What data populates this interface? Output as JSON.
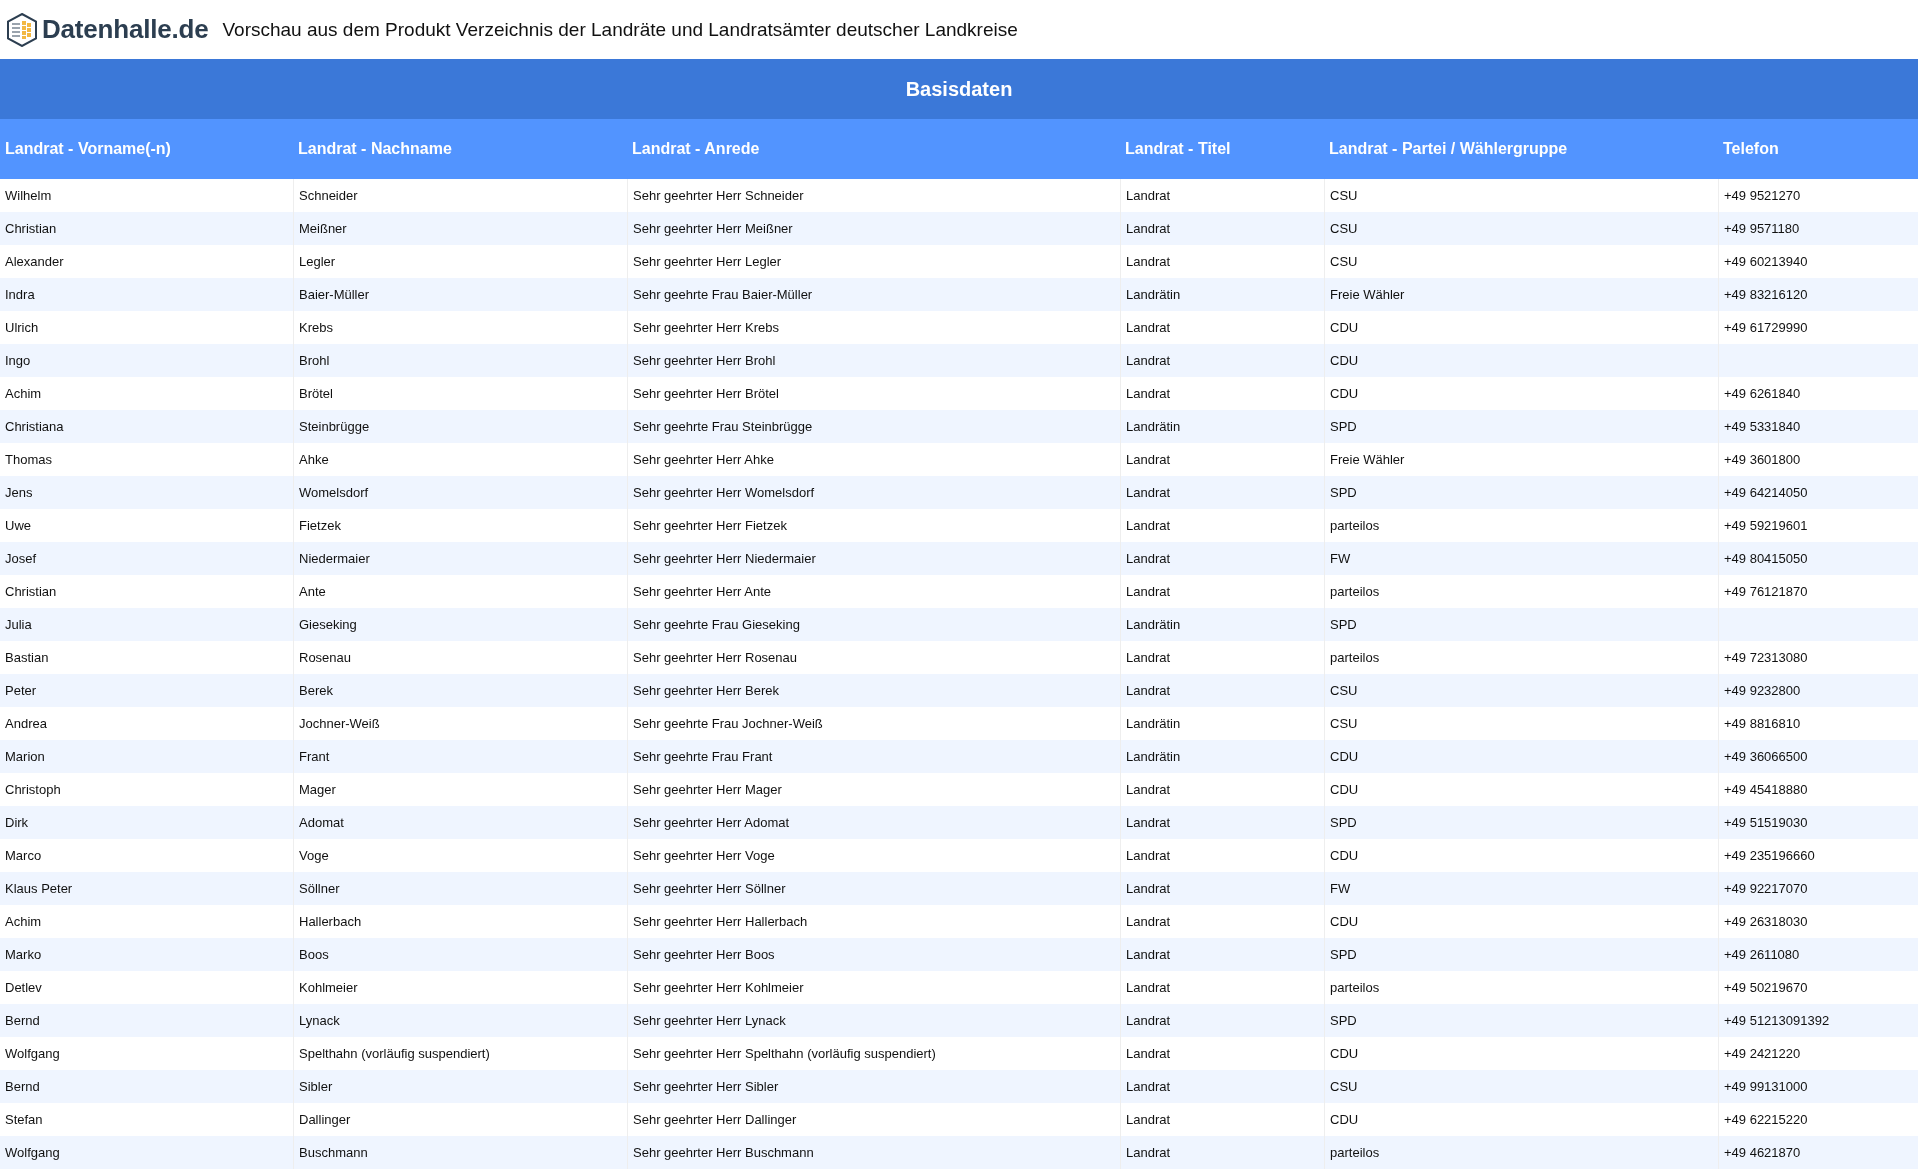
{
  "header": {
    "logo_text": "Datenhalle.de",
    "title": "Vorschau aus dem Produkt Verzeichnis der Landräte und Landratsämter deutscher Landkreise"
  },
  "table": {
    "section_title": "Basisdaten",
    "columns": [
      "Landrat - Vorname(-n)",
      "Landrat - Nachname",
      "Landrat - Anrede",
      "Landrat - Titel",
      "Landrat - Partei / Wählergruppe",
      "Telefon"
    ],
    "rows": [
      {
        "first_name": "Wilhelm",
        "last_name": "Schneider",
        "salutation": "Sehr geehrter Herr Schneider",
        "title": "Landrat",
        "party": "CSU",
        "phone": "+49 9521270"
      },
      {
        "first_name": "Christian",
        "last_name": "Meißner",
        "salutation": "Sehr geehrter Herr Meißner",
        "title": "Landrat",
        "party": "CSU",
        "phone": "+49 9571180"
      },
      {
        "first_name": "Alexander",
        "last_name": "Legler",
        "salutation": "Sehr geehrter Herr Legler",
        "title": "Landrat",
        "party": "CSU",
        "phone": "+49 60213940"
      },
      {
        "first_name": "Indra",
        "last_name": "Baier-Müller",
        "salutation": "Sehr geehrte Frau Baier-Müller",
        "title": "Landrätin",
        "party": "Freie Wähler",
        "phone": "+49 83216120"
      },
      {
        "first_name": "Ulrich",
        "last_name": "Krebs",
        "salutation": "Sehr geehrter Herr Krebs",
        "title": "Landrat",
        "party": "CDU",
        "phone": "+49 61729990"
      },
      {
        "first_name": "Ingo",
        "last_name": "Brohl",
        "salutation": "Sehr geehrter Herr Brohl",
        "title": "Landrat",
        "party": "CDU"
      },
      {
        "first_name": "Achim",
        "last_name": "Brötel",
        "salutation": "Sehr geehrter Herr Brötel",
        "title": "Landrat",
        "party": "CDU",
        "phone": "+49 6261840"
      },
      {
        "first_name": "Christiana",
        "last_name": "Steinbrügge",
        "salutation": "Sehr geehrte Frau Steinbrügge",
        "title": "Landrätin",
        "party": "SPD",
        "phone": "+49 5331840"
      },
      {
        "first_name": "Thomas",
        "last_name": "Ahke",
        "salutation": "Sehr geehrter Herr Ahke",
        "title": "Landrat",
        "party": "Freie Wähler",
        "phone": "+49 3601800"
      },
      {
        "first_name": "Jens",
        "last_name": "Womelsdorf",
        "salutation": "Sehr geehrter Herr Womelsdorf",
        "title": "Landrat",
        "party": "SPD",
        "phone": "+49 64214050"
      },
      {
        "first_name": "Uwe",
        "last_name": "Fietzek",
        "salutation": "Sehr geehrter Herr Fietzek",
        "title": "Landrat",
        "party": "parteilos",
        "phone": "+49 59219601"
      },
      {
        "first_name": "Josef",
        "last_name": "Niedermaier",
        "salutation": "Sehr geehrter Herr Niedermaier",
        "title": "Landrat",
        "party": "FW",
        "phone": "+49 80415050"
      },
      {
        "first_name": "Christian",
        "last_name": "Ante",
        "salutation": "Sehr geehrter Herr Ante",
        "title": "Landrat",
        "party": "parteilos",
        "phone": "+49 76121870"
      },
      {
        "first_name": "Julia",
        "last_name": "Gieseking",
        "salutation": "Sehr geehrte Frau Gieseking",
        "title": "Landrätin",
        "party": "SPD"
      },
      {
        "first_name": "Bastian",
        "last_name": "Rosenau",
        "salutation": "Sehr geehrter Herr Rosenau",
        "title": "Landrat",
        "party": "parteilos",
        "phone": "+49 72313080"
      },
      {
        "first_name": "Peter",
        "last_name": "Berek",
        "salutation": "Sehr geehrter Herr Berek",
        "title": "Landrat",
        "party": "CSU",
        "phone": "+49 9232800"
      },
      {
        "first_name": "Andrea",
        "last_name": "Jochner-Weiß",
        "salutation": "Sehr geehrte Frau Jochner-Weiß",
        "title": "Landrätin",
        "party": "CSU",
        "phone": "+49 8816810"
      },
      {
        "first_name": "Marion",
        "last_name": "Frant",
        "salutation": "Sehr geehrte Frau Frant",
        "title": "Landrätin",
        "party": "CDU",
        "phone": "+49 36066500"
      },
      {
        "first_name": "Christoph",
        "last_name": "Mager",
        "salutation": "Sehr geehrter Herr Mager",
        "title": "Landrat",
        "party": "CDU",
        "phone": "+49 45418880"
      },
      {
        "first_name": "Dirk",
        "last_name": "Adomat",
        "salutation": "Sehr geehrter Herr Adomat",
        "title": "Landrat",
        "party": "SPD",
        "phone": "+49 51519030"
      },
      {
        "first_name": "Marco",
        "last_name": "Voge",
        "salutation": "Sehr geehrter Herr Voge",
        "title": "Landrat",
        "party": "CDU",
        "phone": "+49 235196660"
      },
      {
        "first_name": "Klaus Peter",
        "last_name": "Söllner",
        "salutation": "Sehr geehrter Herr Söllner",
        "title": "Landrat",
        "party": "FW",
        "phone": "+49 92217070"
      },
      {
        "first_name": "Achim",
        "last_name": "Hallerbach",
        "salutation": "Sehr geehrter Herr Hallerbach",
        "title": "Landrat",
        "party": "CDU",
        "phone": "+49 26318030"
      },
      {
        "first_name": "Marko",
        "last_name": "Boos",
        "salutation": "Sehr geehrter Herr Boos",
        "title": "Landrat",
        "party": "SPD",
        "phone": "+49 2611080"
      },
      {
        "first_name": "Detlev",
        "last_name": "Kohlmeier",
        "salutation": "Sehr geehrter Herr Kohlmeier",
        "title": "Landrat",
        "party": "parteilos",
        "phone": "+49 50219670"
      },
      {
        "first_name": "Bernd",
        "last_name": "Lynack",
        "salutation": "Sehr geehrter Herr Lynack",
        "title": "Landrat",
        "party": "SPD",
        "phone": "+49 51213091392"
      },
      {
        "first_name": "Wolfgang",
        "last_name": "Spelthahn (vorläufig suspendiert)",
        "salutation": "Sehr geehrter Herr Spelthahn (vorläufig suspendiert)",
        "title": "Landrat",
        "party": "CDU",
        "phone": "+49 2421220"
      },
      {
        "first_name": "Bernd",
        "last_name": "Sibler",
        "salutation": "Sehr geehrter Herr Sibler",
        "title": "Landrat",
        "party": "CSU",
        "phone": "+49 99131000"
      },
      {
        "first_name": "Stefan",
        "last_name": "Dallinger",
        "salutation": "Sehr geehrter Herr Dallinger",
        "title": "Landrat",
        "party": "CDU",
        "phone": "+49 62215220"
      },
      {
        "first_name": "Wolfgang",
        "last_name": "Buschmann",
        "salutation": "Sehr geehrter Herr Buschmann",
        "title": "Landrat",
        "party": "parteilos",
        "phone": "+49 4621870"
      }
    ]
  }
}
